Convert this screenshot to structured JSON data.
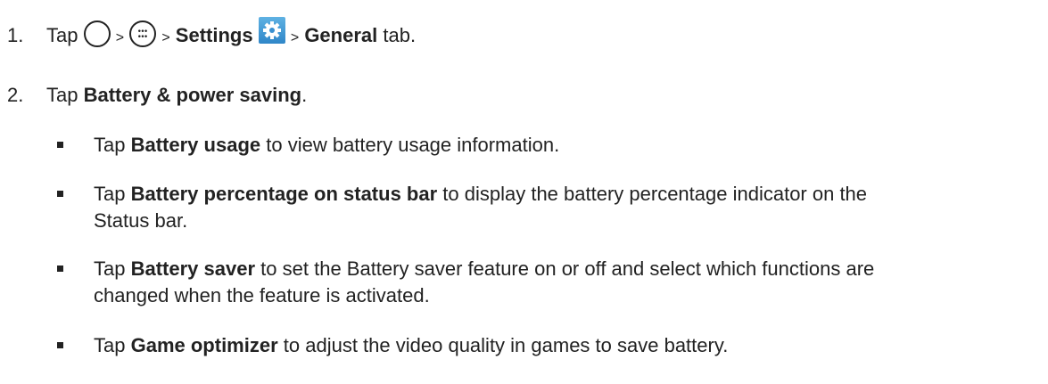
{
  "steps": [
    {
      "number": "1.",
      "tap": "Tap",
      "sep1": ">",
      "sep2": ">",
      "settings": "Settings",
      "sep3": ">",
      "general": "General",
      "tab": "tab."
    },
    {
      "number": "2.",
      "tap": "Tap",
      "bold": "Battery & power saving",
      "period": "."
    }
  ],
  "bullets": [
    {
      "tap": "Tap",
      "bold": "Battery usage",
      "rest": "to view battery usage information.",
      "cont": ""
    },
    {
      "tap": "Tap",
      "bold": "Battery percentage on status bar",
      "rest": "to display the battery percentage indicator on the",
      "cont": "Status bar."
    },
    {
      "tap": "Tap",
      "bold": "Battery saver",
      "rest": "to set the Battery saver feature on or off and select which functions are",
      "cont": "changed when the feature is activated."
    },
    {
      "tap": "Tap",
      "bold": "Game optimizer",
      "rest": "to adjust the video quality in games to save battery.",
      "cont": ""
    }
  ],
  "icons": {
    "home": "home-button-icon",
    "apps": "apps-icon",
    "settings": "settings-gear-icon",
    "settings_color": "#3a90d0"
  }
}
